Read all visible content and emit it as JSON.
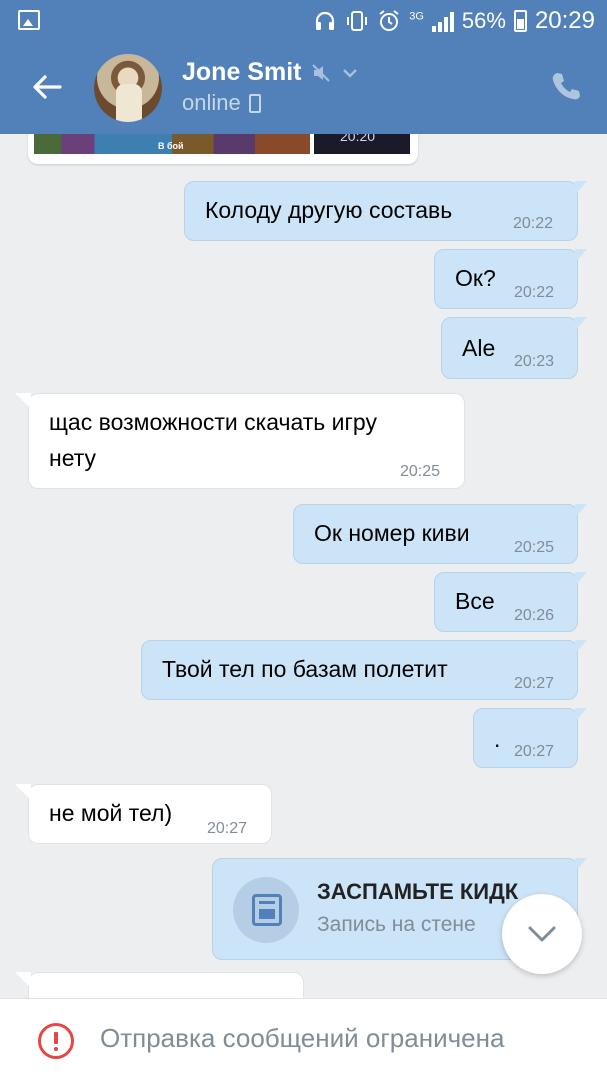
{
  "status_bar": {
    "battery": "56%",
    "time": "20:29",
    "network": "3G"
  },
  "header": {
    "contact_name": "Jone Smit",
    "presence": "online"
  },
  "top_image": {
    "label": "В бой",
    "time": "20:20"
  },
  "messages": [
    {
      "direction": "out",
      "text": "Колоду другую составь",
      "time": "20:22"
    },
    {
      "direction": "out",
      "text": "Ок?",
      "time": "20:22"
    },
    {
      "direction": "out",
      "text": "Ale",
      "time": "20:23"
    },
    {
      "direction": "in",
      "text": "щас возможности скачать игру нету",
      "line1": "щас возможности скачать игру",
      "line2": "нету",
      "time": "20:25"
    },
    {
      "direction": "out",
      "text": "Ок номер киви",
      "time": "20:25"
    },
    {
      "direction": "out",
      "text": "Все",
      "time": "20:26"
    },
    {
      "direction": "out",
      "text": "Твой тел по базам полетит",
      "time": "20:27"
    },
    {
      "direction": "out",
      "text": ".",
      "time": "20:27"
    },
    {
      "direction": "in",
      "text": "не мой тел)",
      "time": "20:27"
    }
  ],
  "wall_post": {
    "title": "ЗАСПАМЬТЕ КИДК",
    "subtitle": "Запись на стене"
  },
  "bottom_notice": "Отправка сообщений ограничена",
  "colors": {
    "header_blue": "#5181b8",
    "outgoing_bubble": "#cce4f7",
    "incoming_bubble": "#ffffff",
    "background": "#edeef0",
    "warning_red": "#e64646",
    "muted_text": "#818c99"
  }
}
